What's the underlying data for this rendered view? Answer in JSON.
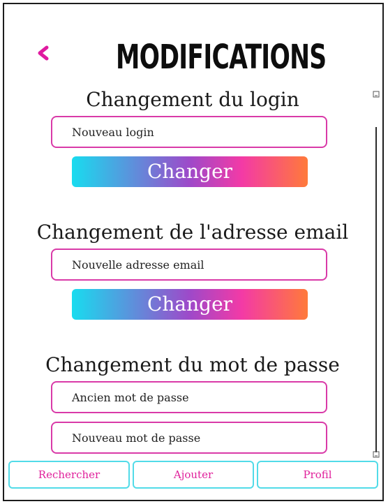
{
  "header": {
    "back_icon": "chevron-left-icon",
    "title": "MODIFICATIONS"
  },
  "sections": {
    "login": {
      "title": "Changement du login",
      "field_placeholder": "Nouveau login",
      "button_label": "Changer"
    },
    "email": {
      "title": "Changement de l'adresse email",
      "field_placeholder": "Nouvelle adresse email",
      "button_label": "Changer"
    },
    "password": {
      "title": "Changement du mot de passe",
      "old_placeholder": "Ancien mot de passe",
      "new_placeholder": "Nouveau mot de passe"
    }
  },
  "nav": {
    "search_label": "Rechercher",
    "add_label": "Ajouter",
    "profile_label": "Profil"
  },
  "colors": {
    "accent_pink": "#e01aa0",
    "field_border": "#d93aa8",
    "nav_border": "#52dbe8",
    "gradient_start": "#18dcef",
    "gradient_mid": "#f33aa6",
    "gradient_end": "#ff7a3a"
  }
}
